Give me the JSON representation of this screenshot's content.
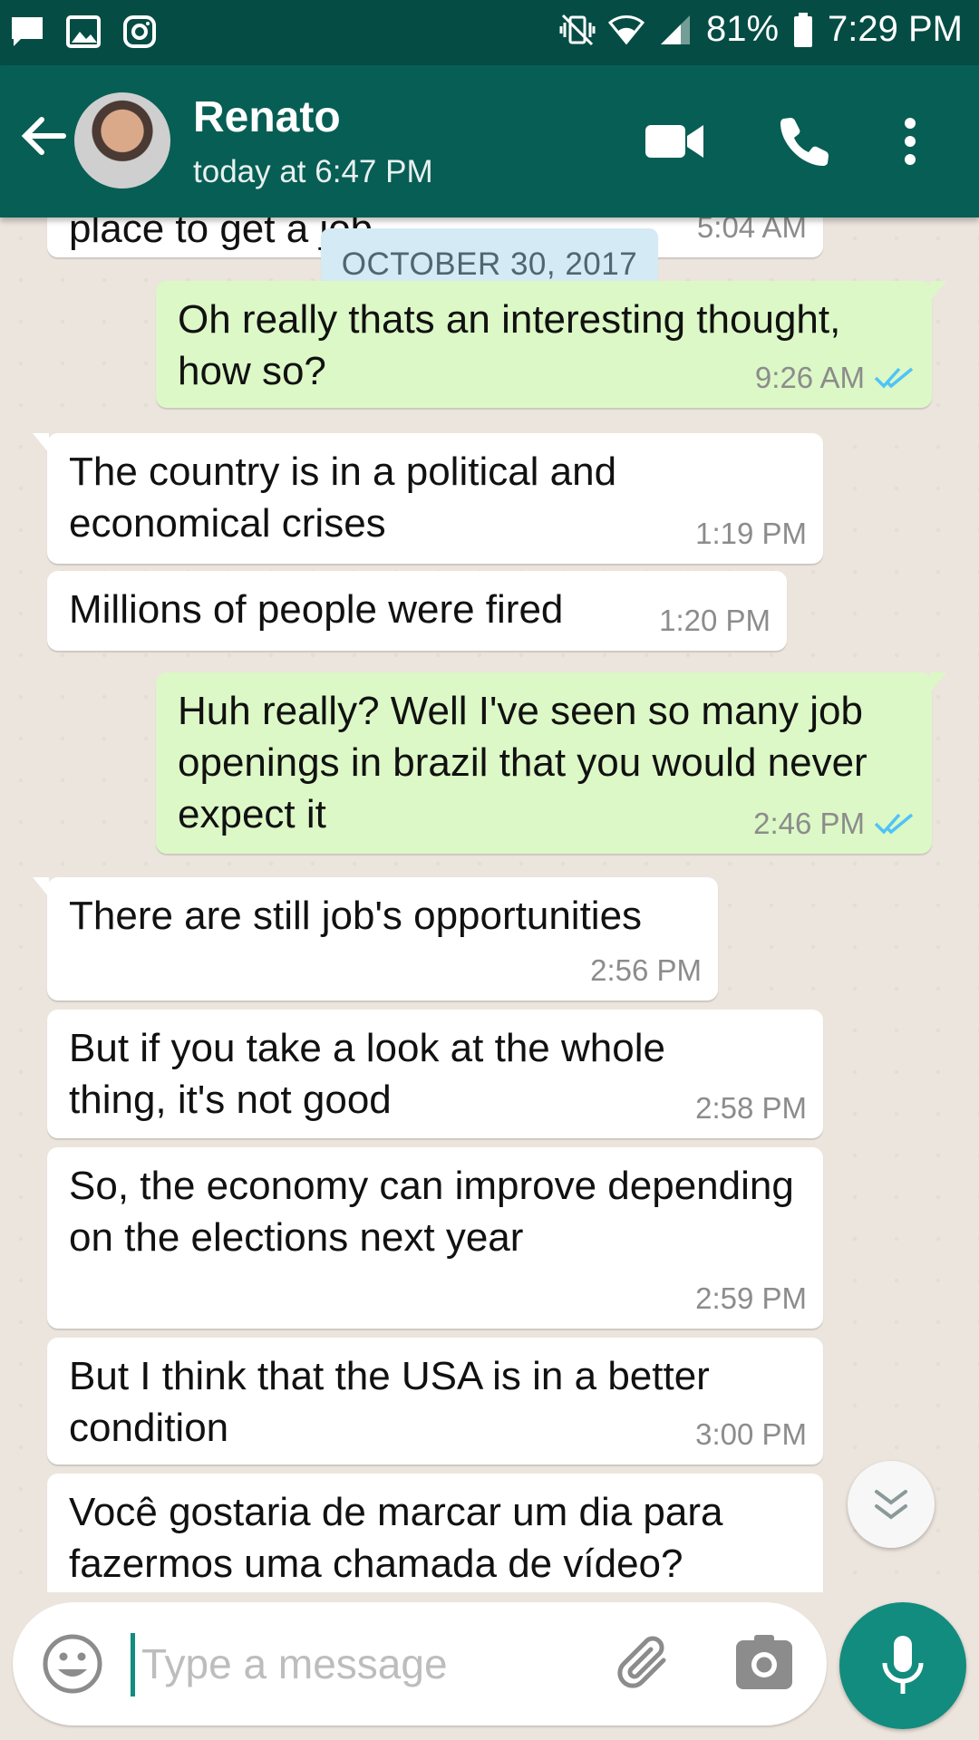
{
  "status_bar": {
    "battery": "81%",
    "time": "7:29 PM",
    "left_icons": [
      "message-notification-icon",
      "gallery-notification-icon",
      "instagram-notification-icon"
    ],
    "right_icons": [
      "vibrate-icon",
      "wifi-icon",
      "signal-icon",
      "battery-icon"
    ]
  },
  "header": {
    "contact_name": "Renato",
    "status": "today at 6:47 PM",
    "icons": [
      "back-arrow-icon",
      "video-call-icon",
      "phone-icon",
      "more-options-icon"
    ]
  },
  "chat": {
    "date_divider": "OCTOBER 30, 2017",
    "partial_top": {
      "text": "place to get a job",
      "time": "5:04 AM"
    },
    "messages": [
      {
        "direction": "out",
        "text": "Oh really thats an interesting thought, how so?",
        "time": "9:26 AM",
        "read": true
      },
      {
        "direction": "in",
        "text": "The country is in a political and economical crises",
        "time": "1:19 PM"
      },
      {
        "direction": "in",
        "text": "Millions of people were fired",
        "time": "1:20 PM"
      },
      {
        "direction": "out",
        "text": "Huh really? Well I've seen so many job openings in brazil that you would never expect it",
        "time": "2:46 PM",
        "read": true
      },
      {
        "direction": "in",
        "text": "There are still job's opportunities",
        "time": "2:56 PM"
      },
      {
        "direction": "in",
        "text": "But if you take a look at the whole thing, it's not good",
        "time": "2:58 PM"
      },
      {
        "direction": "in",
        "text": "So, the economy can improve depending on the elections next year",
        "time": "2:59 PM"
      },
      {
        "direction": "in",
        "text": "But I think that the USA is in a better condition",
        "time": "3:00 PM"
      },
      {
        "direction": "in",
        "text": "Você gostaria de marcar um dia para fazermos uma chamada de vídeo?",
        "time": ""
      }
    ]
  },
  "input": {
    "placeholder": "Type a message",
    "value": ""
  },
  "colors": {
    "header": "#075e54",
    "status_bar": "#054d44",
    "outgoing_bubble": "#dcf8c6",
    "incoming_bubble": "#ffffff",
    "accent": "#128c7e",
    "read_ticks": "#4fc3f7"
  }
}
